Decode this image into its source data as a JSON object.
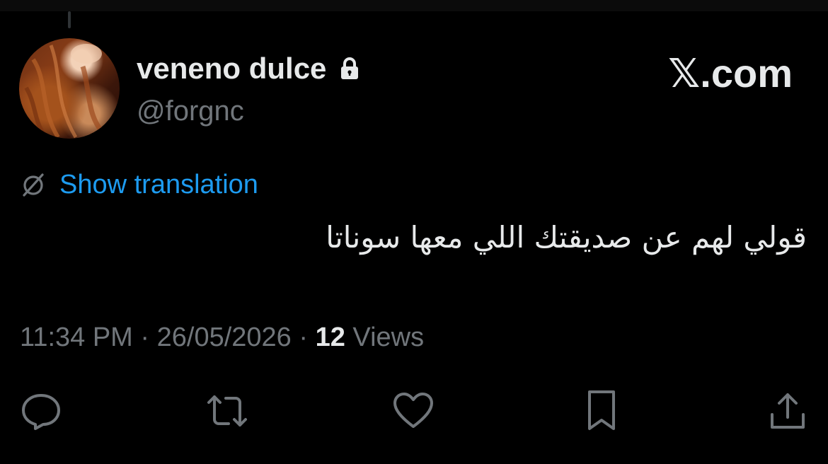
{
  "author": {
    "display_name": "veneno dulce",
    "handle": "@forgnc",
    "avatar_icon": "avatar-photo",
    "protected_icon": "lock-icon"
  },
  "brand": {
    "text": "𝕏.com"
  },
  "translation": {
    "label": "Show translation",
    "icon": "translate-icon",
    "color": "#1d9bf0"
  },
  "tweet": {
    "text": "قولي لهم عن صديقتك اللي معها سوناتا"
  },
  "meta": {
    "time": "11:34 PM",
    "separator": " · ",
    "date": "26/05/2026",
    "views_count": "12",
    "views_label": " Views"
  },
  "actions": [
    {
      "name": "reply",
      "icon": "reply-icon"
    },
    {
      "name": "repost",
      "icon": "repost-icon"
    },
    {
      "name": "like",
      "icon": "heart-icon"
    },
    {
      "name": "bookmark",
      "icon": "bookmark-icon"
    },
    {
      "name": "share",
      "icon": "share-icon"
    }
  ],
  "colors": {
    "background": "#000000",
    "primary_text": "#e7e9ea",
    "secondary_text": "#71767b"
  }
}
